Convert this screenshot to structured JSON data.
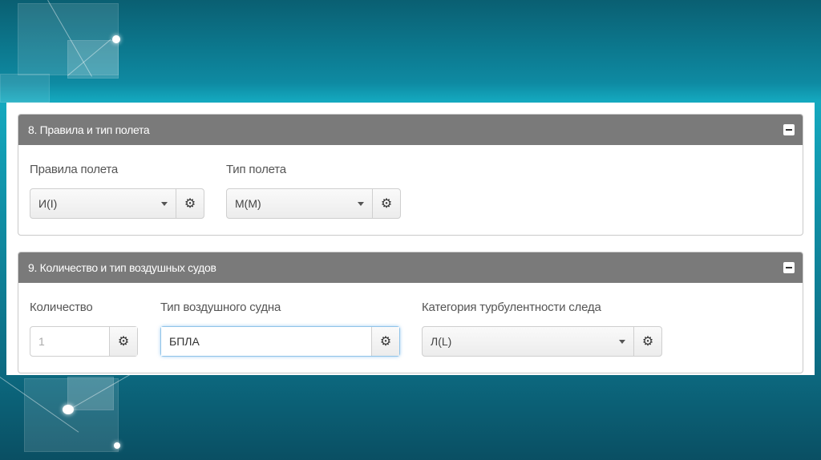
{
  "section8": {
    "title": "8. Правила и тип полета",
    "flight_rules": {
      "label": "Правила полета",
      "value": "И(I)"
    },
    "flight_type": {
      "label": "Тип полета",
      "value": "М(М)"
    }
  },
  "section9": {
    "title": "9. Количество и тип воздушных судов",
    "quantity": {
      "label": "Количество",
      "value": "1"
    },
    "aircraft_type": {
      "label": "Тип воздушного судна",
      "value": "БПЛА"
    },
    "turbulence": {
      "label": "Категория турбулентности следа",
      "value": "Л(L)"
    }
  },
  "icons": {
    "settings": "gear-icon",
    "collapse": "minus-icon",
    "dropdown": "caret-down-icon"
  }
}
